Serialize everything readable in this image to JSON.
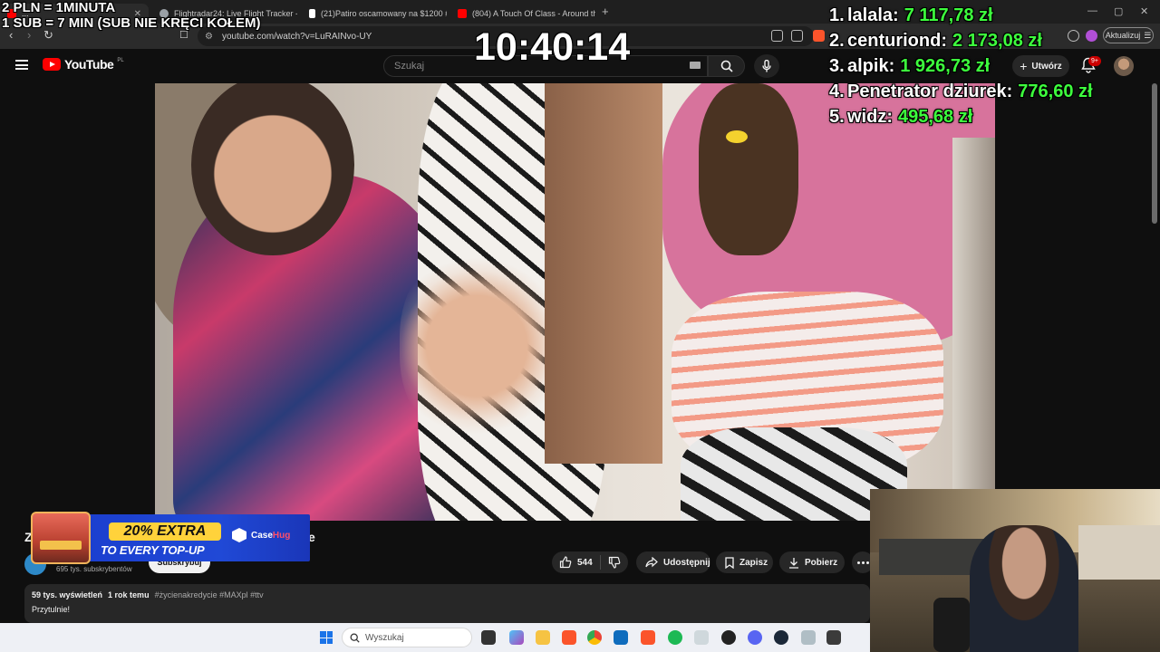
{
  "overlay": {
    "rate_line1": "2 PLN = 1MINUTA",
    "rate_line2": "1 SUB = 7 MIN (SUB NIE KRĘCI KOŁEM)",
    "clock": "10:40:14",
    "leaderboard": [
      {
        "rank": "1.",
        "name": "lalala:",
        "amount": "7 117,78 zł"
      },
      {
        "rank": "2.",
        "name": "centuriond:",
        "amount": "2 173,08 zł"
      },
      {
        "rank": "3.",
        "name": "alpik:",
        "amount": "1 926,73 zł"
      },
      {
        "rank": "4.",
        "name": "Penetrator dziurek:",
        "amount": "776,60 zł"
      },
      {
        "rank": "5.",
        "name": "widz:",
        "amount": "495,68 zł"
      }
    ]
  },
  "browser": {
    "tabs": [
      {
        "title": "...",
        "active": true,
        "favicon_color": "#ff0000"
      },
      {
        "title": "Flightradar24: Live Flight Tracker - Re",
        "active": false,
        "favicon_color": "#9aa0a6"
      },
      {
        "title": "(21)Patiro oscamowany na $1200 #p",
        "active": false,
        "favicon_color": "#ffffff"
      },
      {
        "title": "(804) A Touch Of Class - Around the",
        "active": false,
        "favicon_color": "#ff0000"
      }
    ],
    "url": "youtube.com/watch?v=LuRAINvo-UY",
    "update_label": "Aktualizuj"
  },
  "youtube": {
    "logo_text": "YouTube",
    "logo_region": "PL",
    "search_placeholder": "Szukaj",
    "create_label": "Utwórz",
    "notifications_badge": "9+"
  },
  "video_meta": {
    "title_partial": "Z",
    "title_end": "e",
    "subscribers": "695 tys. subskrybentów",
    "subscribe_label": "Subskrybuj",
    "likes": "544",
    "share_label": "Udostępnij",
    "save_label": "Zapisz",
    "download_label": "Pobierz",
    "views": "59 tys. wyświetleń",
    "uploaded": "1 rok temu",
    "tags": "#życienakredycie #MAXpl #ttv",
    "description": "Przytulnie!"
  },
  "ad": {
    "headline": "20% EXTRA",
    "subline": "TO EVERY TOP-UP",
    "brand_part1": "Case",
    "brand_part2": "Hug"
  },
  "taskbar": {
    "search_placeholder": "Wyszukaj"
  },
  "colors": {
    "yt_bg": "#0f0f0f",
    "leaderboard_amount": "#3dff3d",
    "yt_red": "#ff0000",
    "promo_blue": "#1b3fcf",
    "promo_yellow": "#ffd23b"
  }
}
